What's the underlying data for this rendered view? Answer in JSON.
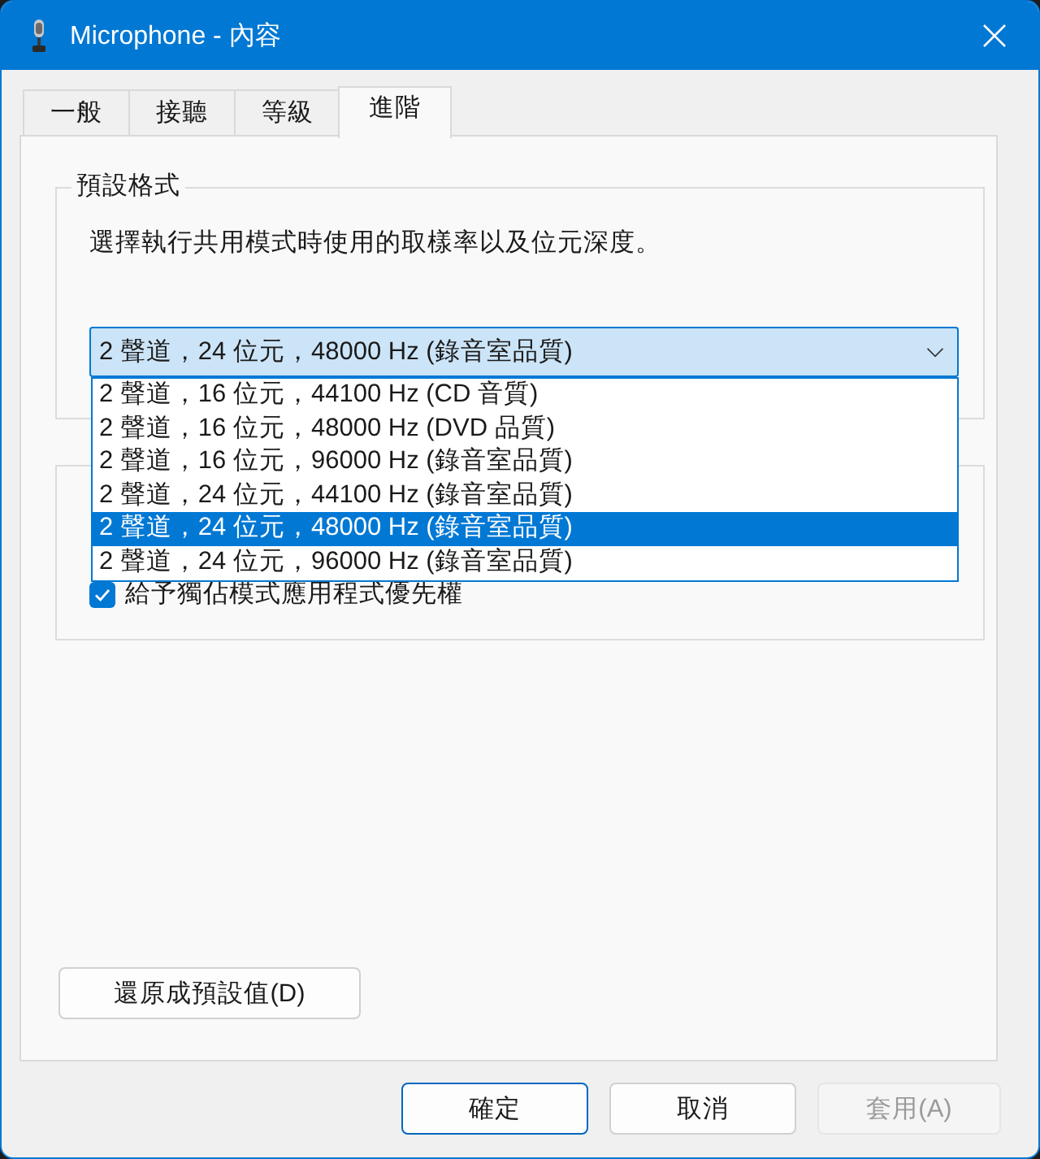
{
  "window": {
    "title": "Microphone - 內容"
  },
  "tabs": [
    {
      "label": "一般",
      "selected": false
    },
    {
      "label": "接聽",
      "selected": false
    },
    {
      "label": "等級",
      "selected": false
    },
    {
      "label": "進階",
      "selected": true
    }
  ],
  "default_format": {
    "title": "預設格式",
    "description": "選擇執行共用模式時使用的取樣率以及位元深度。",
    "dropdown": {
      "value": "2 聲道，24 位元，48000 Hz (錄音室品質)",
      "expanded": true,
      "options": [
        {
          "label": "2 聲道，16 位元，44100 Hz (CD 音質)",
          "selected": false
        },
        {
          "label": "2 聲道，16 位元，48000 Hz (DVD 品質)",
          "selected": false
        },
        {
          "label": "2 聲道，16 位元，96000 Hz (錄音室品質)",
          "selected": false
        },
        {
          "label": "2 聲道，24 位元，44100 Hz (錄音室品質)",
          "selected": false
        },
        {
          "label": "2 聲道，24 位元，48000 Hz (錄音室品質)",
          "selected": true
        },
        {
          "label": "2 聲道，24 位元，96000 Hz (錄音室品質)",
          "selected": false
        }
      ]
    }
  },
  "exclusive_mode": {
    "checkboxes": [
      {
        "label": "給予獨佔模式應用程式優先權",
        "checked": true
      }
    ]
  },
  "restore_button": {
    "label": "還原成預設值(D)"
  },
  "buttons": [
    {
      "label": "確定",
      "default": true,
      "disabled": false
    },
    {
      "label": "取消",
      "default": false,
      "disabled": false
    },
    {
      "label": "套用(A)",
      "default": false,
      "disabled": true
    }
  ]
}
